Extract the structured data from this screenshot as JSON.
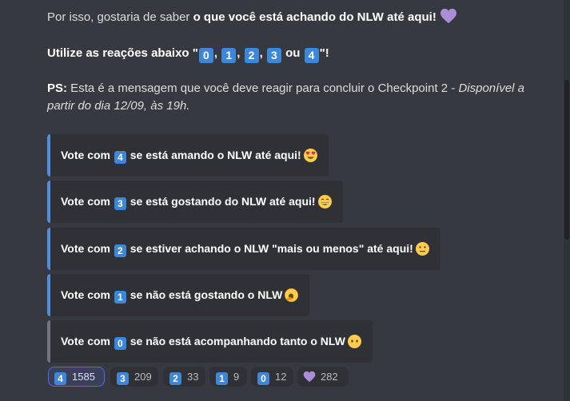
{
  "intro": {
    "prefix": "Por isso, gostaria de saber ",
    "bold": "o que você está achando do NLW até aqui!"
  },
  "instruction": {
    "prefix": "Utilize as reações abaixo \"",
    "keys": [
      "0",
      "1",
      "2",
      "3"
    ],
    "or_word": "ou",
    "last_key": "4",
    "suffix": "\"!"
  },
  "ps": {
    "label": "PS:",
    "text": " Esta é a mensagem que você deve reagir para concluir o Checkpoint 2 - ",
    "italic_line1": "Disponível a",
    "italic_line2": "partir do dia 12/09, às 19h."
  },
  "embeds": [
    {
      "prefix": "Vote com",
      "key": "4",
      "text": "se está amando o NLW até aqui!",
      "emoji": "heart-eyes-emoji"
    },
    {
      "prefix": "Vote com",
      "key": "3",
      "text": "se está gostando do NLW até aqui!",
      "emoji": "grinning-emoji"
    },
    {
      "prefix": "Vote com",
      "key": "2",
      "text": "se estiver achando o NLW \"mais ou menos\" até aqui!",
      "emoji": "neutral-face-emoji"
    },
    {
      "prefix": "Vote com",
      "key": "1",
      "text": "se não está gostando o NLW",
      "emoji": "yawning-emoji"
    },
    {
      "prefix": "Vote com",
      "key": "0",
      "text": "se não está acompanhando tanto o NLW",
      "emoji": "no-mouth-emoji"
    }
  ],
  "reactions": [
    {
      "emoji": "4",
      "count": "1585",
      "active": true
    },
    {
      "emoji": "3",
      "count": "209",
      "active": false
    },
    {
      "emoji": "2",
      "count": "33",
      "active": false
    },
    {
      "emoji": "1",
      "count": "9",
      "active": false
    },
    {
      "emoji": "0",
      "count": "12",
      "active": false
    },
    {
      "emoji": "purple-heart",
      "count": "282",
      "active": false
    }
  ],
  "colors": {
    "background": "#36393f",
    "embed_bg": "#2f3136",
    "embed_border_blue": "#4f8fe0",
    "embed_border_gray": "#72767d",
    "keycap_blue": "#3d87d9",
    "active_reaction_border": "#5865f2",
    "heart_purple": "#aa8ed6"
  }
}
